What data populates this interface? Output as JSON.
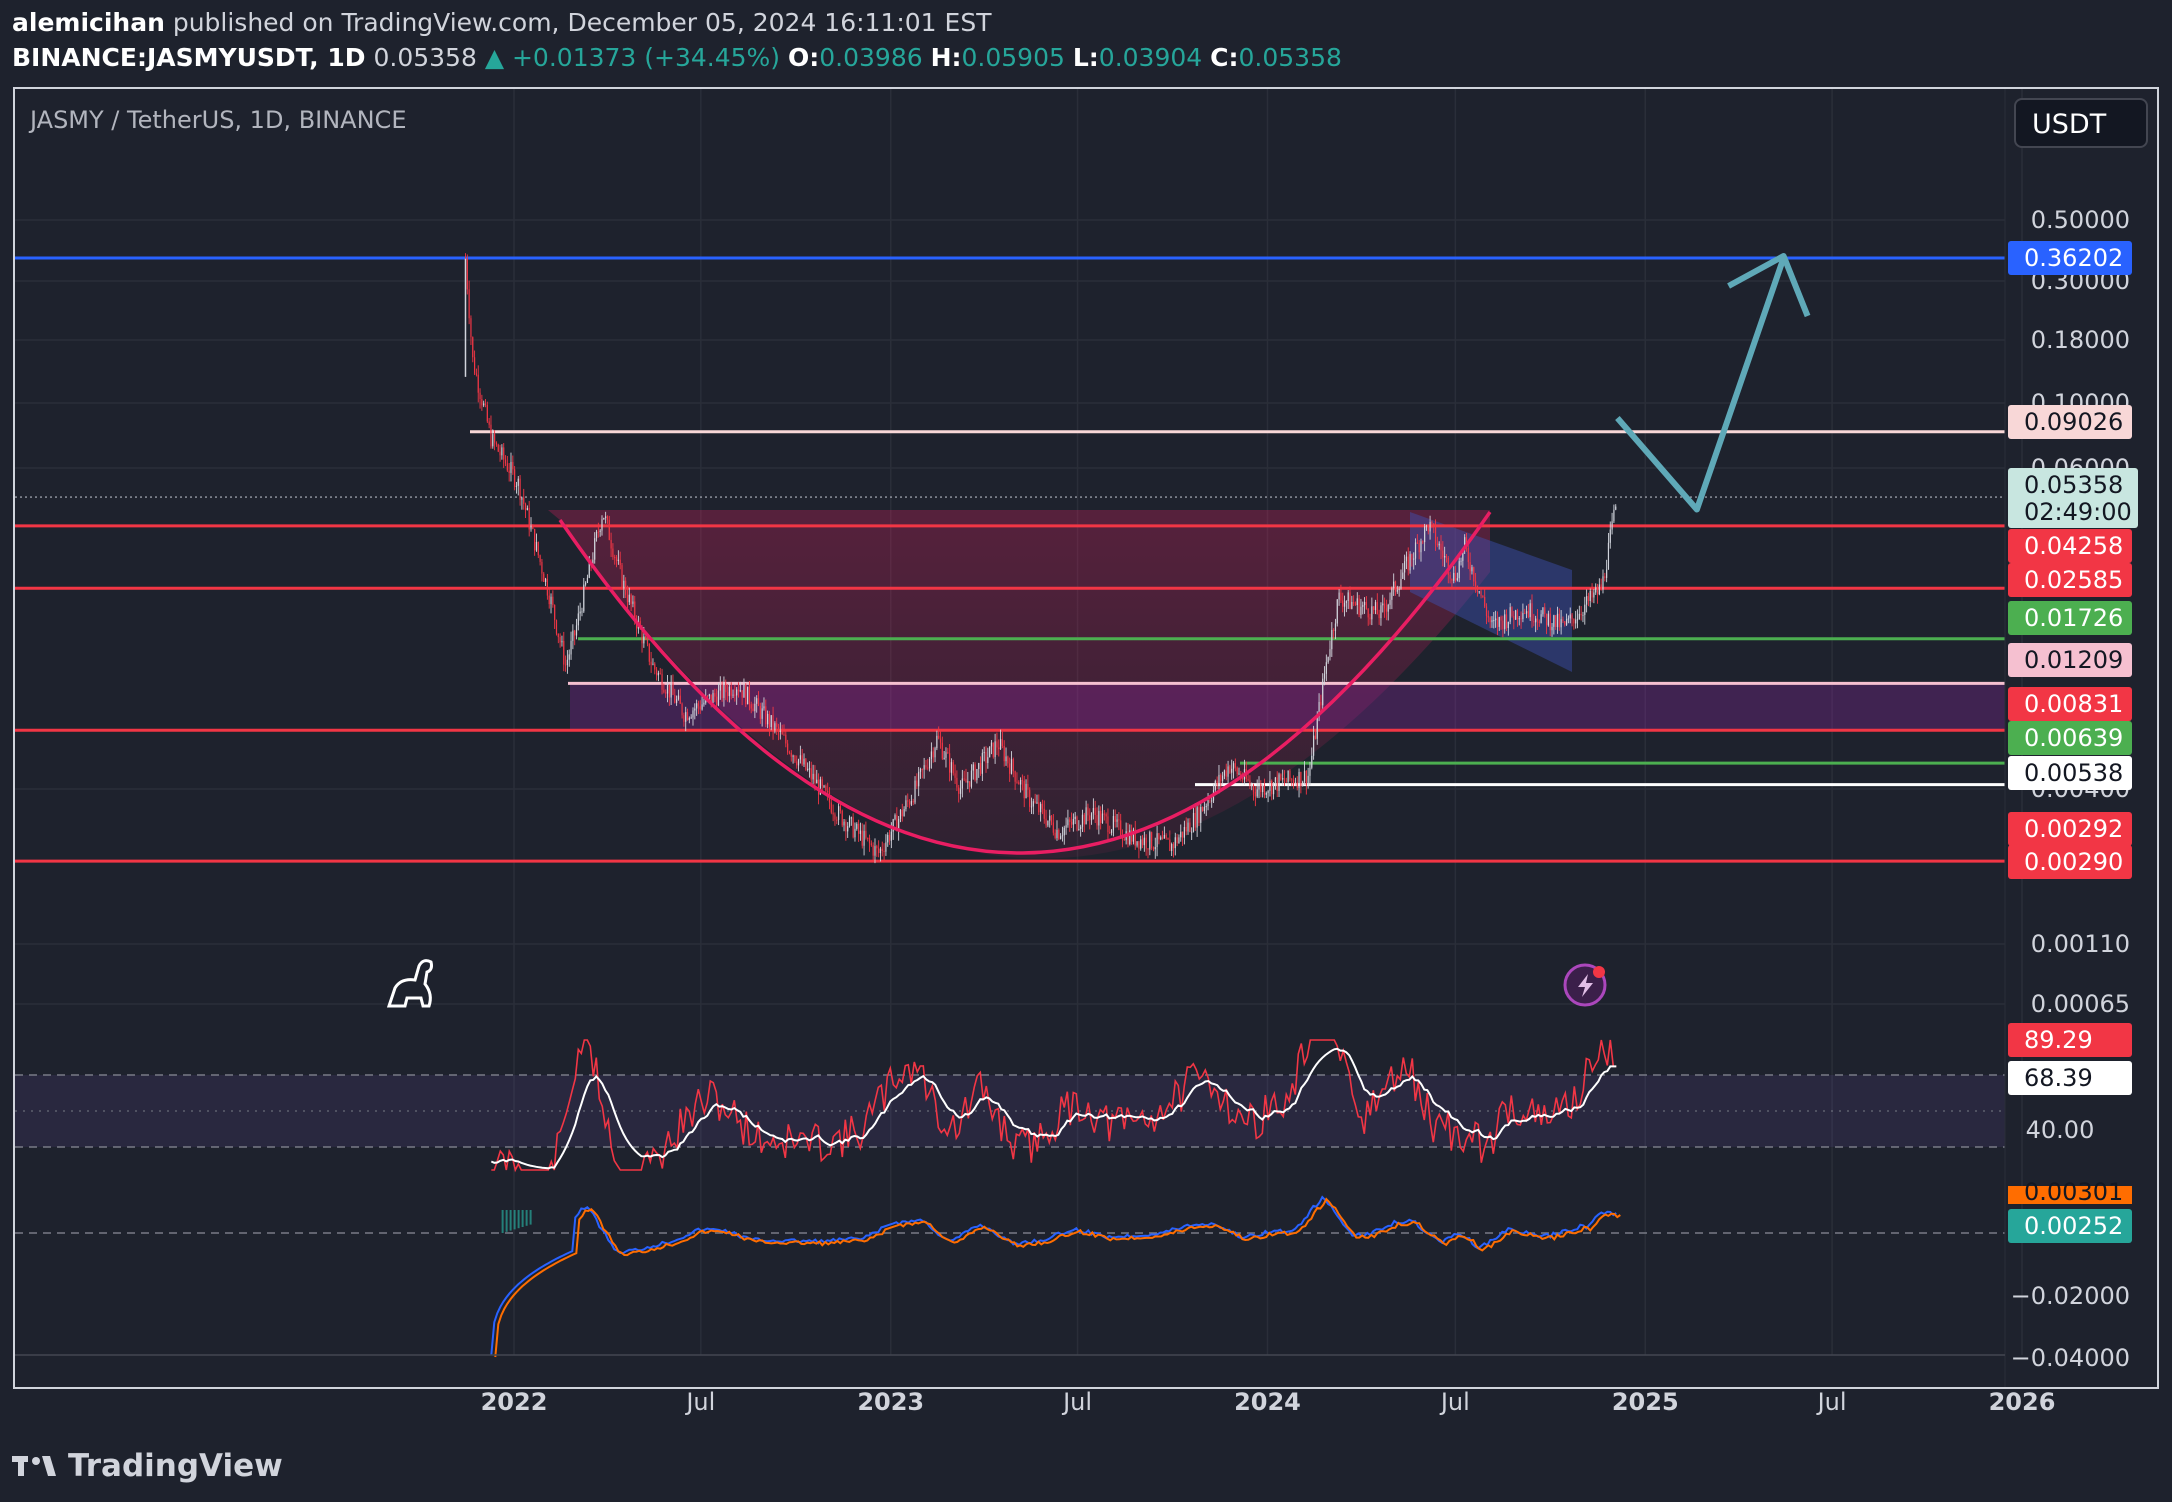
{
  "header": {
    "author": "alemicihan",
    "published": "published on TradingView.com, December 05, 2024 16:11:01 EST",
    "symbol": "BINANCE:JASMYUSDT, 1D",
    "last": "0.05358",
    "change": "▲ +0.01373 (+34.45%)",
    "o_label": "O:",
    "o": "0.03986",
    "h_label": "H:",
    "h": "0.05905",
    "l_label": "L:",
    "l": "0.03904",
    "c_label": "C:",
    "c": "0.05358"
  },
  "chart_title": "JASMY / TetherUS, 1D, BINANCE",
  "currency_button": "USDT",
  "brand": "TradingView",
  "colors": {
    "background": "#1e222d",
    "grid": "#2a2e39",
    "candle_up": "#d1d4dc",
    "candle_down": "#f23645",
    "support_line": "#f23645",
    "blue_line": "#2962ff",
    "green_line": "#4caf50",
    "cup_arc": "#e91e63",
    "arrow": "#5fa9b8",
    "rsi_line": "#ffffff",
    "rsi_signal": "#f23645",
    "macd": "#2962ff",
    "macd_signal": "#ff6d00",
    "macd_hist": "#26a69a"
  },
  "chart_data": {
    "type": "candlestick",
    "symbol": "JASMYUSDT",
    "timeframe": "1D",
    "scale": "log",
    "x_ticks": [
      {
        "label": "2022",
        "date": "2022-01-01",
        "major": true
      },
      {
        "label": "Jul",
        "date": "2022-07-01",
        "major": false
      },
      {
        "label": "2023",
        "date": "2023-01-01",
        "major": true
      },
      {
        "label": "Jul",
        "date": "2023-07-01",
        "major": false
      },
      {
        "label": "2024",
        "date": "2024-01-01",
        "major": true
      },
      {
        "label": "Jul",
        "date": "2024-07-01",
        "major": false
      },
      {
        "label": "2025",
        "date": "2025-01-01",
        "major": true
      },
      {
        "label": "Jul",
        "date": "2025-07-01",
        "major": false
      },
      {
        "label": "2026",
        "date": "2026-01-01",
        "major": true
      }
    ],
    "y_ticks": [
      "0.50000",
      "0.30000",
      "0.18000",
      "0.10000",
      "0.06000",
      "0.00400",
      "0.00110",
      "0.00065"
    ],
    "price_path": [
      {
        "date": "2021-11-15",
        "price": 0.36
      },
      {
        "date": "2021-11-22",
        "price": 0.16
      },
      {
        "date": "2021-12-10",
        "price": 0.085
      },
      {
        "date": "2022-01-05",
        "price": 0.06
      },
      {
        "date": "2022-02-05",
        "price": 0.024
      },
      {
        "date": "2022-02-20",
        "price": 0.014
      },
      {
        "date": "2022-03-01",
        "price": 0.018
      },
      {
        "date": "2022-03-28",
        "price": 0.048
      },
      {
        "date": "2022-04-15",
        "price": 0.028
      },
      {
        "date": "2022-05-15",
        "price": 0.014
      },
      {
        "date": "2022-06-15",
        "price": 0.0095
      },
      {
        "date": "2022-08-05",
        "price": 0.012
      },
      {
        "date": "2022-09-10",
        "price": 0.0085
      },
      {
        "date": "2022-10-20",
        "price": 0.0055
      },
      {
        "date": "2022-11-10",
        "price": 0.0043
      },
      {
        "date": "2022-12-20",
        "price": 0.0031
      },
      {
        "date": "2023-01-25",
        "price": 0.0052
      },
      {
        "date": "2023-02-15",
        "price": 0.0078
      },
      {
        "date": "2023-03-10",
        "price": 0.0052
      },
      {
        "date": "2023-04-15",
        "price": 0.0075
      },
      {
        "date": "2023-05-15",
        "price": 0.0048
      },
      {
        "date": "2023-06-12",
        "price": 0.0037
      },
      {
        "date": "2023-07-15",
        "price": 0.0043
      },
      {
        "date": "2023-08-25",
        "price": 0.0035
      },
      {
        "date": "2023-09-30",
        "price": 0.0033
      },
      {
        "date": "2023-10-25",
        "price": 0.0042
      },
      {
        "date": "2023-11-25",
        "price": 0.0063
      },
      {
        "date": "2023-12-20",
        "price": 0.0052
      },
      {
        "date": "2024-02-10",
        "price": 0.0058
      },
      {
        "date": "2024-02-28",
        "price": 0.015
      },
      {
        "date": "2024-03-10",
        "price": 0.024
      },
      {
        "date": "2024-04-20",
        "price": 0.021
      },
      {
        "date": "2024-06-05",
        "price": 0.043
      },
      {
        "date": "2024-06-30",
        "price": 0.028
      },
      {
        "date": "2024-07-10",
        "price": 0.036
      },
      {
        "date": "2024-08-05",
        "price": 0.019
      },
      {
        "date": "2024-09-05",
        "price": 0.022
      },
      {
        "date": "2024-10-15",
        "price": 0.019
      },
      {
        "date": "2024-11-20",
        "price": 0.026
      },
      {
        "date": "2024-12-05",
        "price": 0.05358
      }
    ],
    "horizontal_levels": [
      {
        "price": 0.36202,
        "label": "0.36202",
        "color": "#2962ff"
      },
      {
        "price": 0.09026,
        "label": "0.09026",
        "color": "#f8d7d7"
      },
      {
        "price": 0.04258,
        "label": "0.04258",
        "color": "#f23645"
      },
      {
        "price": 0.02585,
        "label": "0.02585",
        "color": "#f23645"
      },
      {
        "price": 0.01726,
        "label": "0.01726",
        "color": "#4caf50"
      },
      {
        "price": 0.01209,
        "label": "0.01209",
        "color": "#f5c0d0"
      },
      {
        "price": 0.00831,
        "label": "0.00831",
        "color": "#f23645"
      },
      {
        "price": 0.00639,
        "label": "0.00639",
        "color": "#4caf50"
      },
      {
        "price": 0.00538,
        "label": "0.00538",
        "color": "#ffffff"
      },
      {
        "price": 0.00292,
        "label": "0.00292",
        "color": "#f23645"
      },
      {
        "price": 0.0029,
        "label": "0.00290",
        "color": "#f23645"
      }
    ],
    "current_price": {
      "label": "0.05358",
      "countdown": "02:49:00"
    },
    "rsi": {
      "ticks": [
        "40.00"
      ],
      "value_labels": [
        "89.29",
        "68.39"
      ],
      "last_rsi": 89.29,
      "last_signal": 68.39
    },
    "macd": {
      "ticks": [
        "−0.02000",
        "−0.04000"
      ],
      "value_labels": [
        "0.00301",
        "0.00252"
      ]
    },
    "annotations": {
      "cup_arc": true,
      "projection_arrow": [
        {
          "date": "2024-12-05",
          "price": 0.09026
        },
        {
          "date": "2025-02-20",
          "price": 0.0485
        },
        {
          "date": "2025-05-15",
          "price": 0.36202
        }
      ]
    }
  }
}
